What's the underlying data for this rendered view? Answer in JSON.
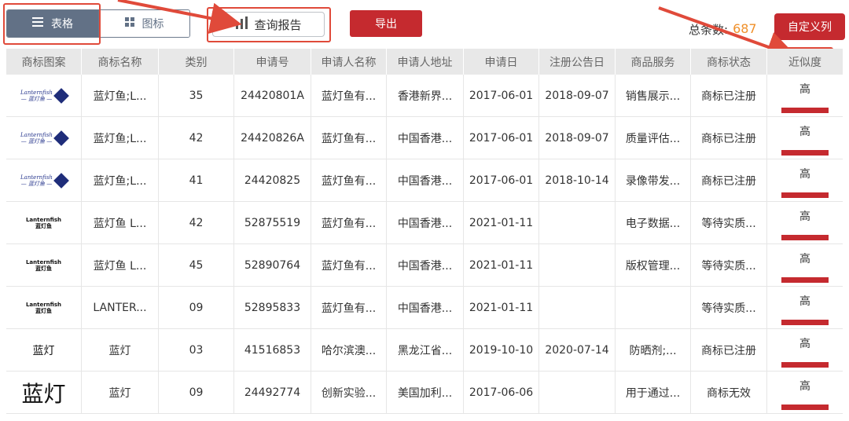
{
  "toolbar": {
    "table_label": "表格",
    "icon_label": "图标",
    "report_label": "查询报告",
    "export_label": "导出",
    "total_label": "总条数:",
    "total_count": "687",
    "custom_columns_label": "自定义列"
  },
  "colors": {
    "accent_red": "#c52a2f",
    "toggle_active": "#627186",
    "count_orange": "#f0902a",
    "annotation": "#e04a3a"
  },
  "table": {
    "headers": [
      "商标图案",
      "商标名称",
      "类别",
      "申请号",
      "申请人名称",
      "申请人地址",
      "申请日",
      "注册公告日",
      "商品服务",
      "商标状态",
      "近似度"
    ],
    "rows": [
      {
        "logo": "lanternfish-color",
        "logo_text": "Lanternfish",
        "logo_sub": "蓝灯鱼",
        "name": "蓝灯鱼;L...",
        "class": "35",
        "app_no": "24420801A",
        "applicant": "蓝灯鱼有...",
        "address": "香港新界...",
        "app_date": "2017-06-01",
        "reg_date": "2018-09-07",
        "goods": "销售展示...",
        "status": "商标已注册",
        "similarity": "高"
      },
      {
        "logo": "lanternfish-color",
        "logo_text": "Lanternfish",
        "logo_sub": "蓝灯鱼",
        "name": "蓝灯鱼;L...",
        "class": "42",
        "app_no": "24420826A",
        "applicant": "蓝灯鱼有...",
        "address": "中国香港...",
        "app_date": "2017-06-01",
        "reg_date": "2018-09-07",
        "goods": "质量评估...",
        "status": "商标已注册",
        "similarity": "高"
      },
      {
        "logo": "lanternfish-color",
        "logo_text": "Lanternfish",
        "logo_sub": "蓝灯鱼",
        "name": "蓝灯鱼;L...",
        "class": "41",
        "app_no": "24420825",
        "applicant": "蓝灯鱼有...",
        "address": "中国香港...",
        "app_date": "2017-06-01",
        "reg_date": "2018-10-14",
        "goods": "录像带发...",
        "status": "商标已注册",
        "similarity": "高"
      },
      {
        "logo": "lanternfish-bw",
        "logo_text": "Lanternfish",
        "logo_sub": "蓝灯鱼",
        "name": "蓝灯鱼 L...",
        "class": "42",
        "app_no": "52875519",
        "applicant": "蓝灯鱼有...",
        "address": "中国香港...",
        "app_date": "2021-01-11",
        "reg_date": "",
        "goods": "电子数据...",
        "status": "等待实质...",
        "similarity": "高"
      },
      {
        "logo": "lanternfish-bw",
        "logo_text": "Lanternfish",
        "logo_sub": "蓝灯鱼",
        "name": "蓝灯鱼 L...",
        "class": "45",
        "app_no": "52890764",
        "applicant": "蓝灯鱼有...",
        "address": "中国香港...",
        "app_date": "2021-01-11",
        "reg_date": "",
        "goods": "版权管理...",
        "status": "等待实质...",
        "similarity": "高"
      },
      {
        "logo": "lanternfish-bw",
        "logo_text": "Lanternfish",
        "logo_sub": "蓝灯鱼",
        "name": "LANTER...",
        "class": "09",
        "app_no": "52895833",
        "applicant": "蓝灯鱼有...",
        "address": "中国香港...",
        "app_date": "2021-01-11",
        "reg_date": "",
        "goods": "",
        "status": "等待实质...",
        "similarity": "高"
      },
      {
        "logo": "cn-small",
        "logo_text": "蓝灯",
        "logo_sub": "",
        "name": "蓝灯",
        "class": "03",
        "app_no": "41516853",
        "applicant": "哈尔滨澳...",
        "address": "黑龙江省...",
        "app_date": "2019-10-10",
        "reg_date": "2020-07-14",
        "goods": "防晒剂;...",
        "status": "商标已注册",
        "similarity": "高"
      },
      {
        "logo": "cn-large",
        "logo_text": "蓝灯",
        "logo_sub": "",
        "name": "蓝灯",
        "class": "09",
        "app_no": "24492774",
        "applicant": "创新实验...",
        "address": "美国加利...",
        "app_date": "2017-06-06",
        "reg_date": "",
        "goods": "用于通过...",
        "status": "商标无效",
        "similarity": "高"
      }
    ]
  }
}
